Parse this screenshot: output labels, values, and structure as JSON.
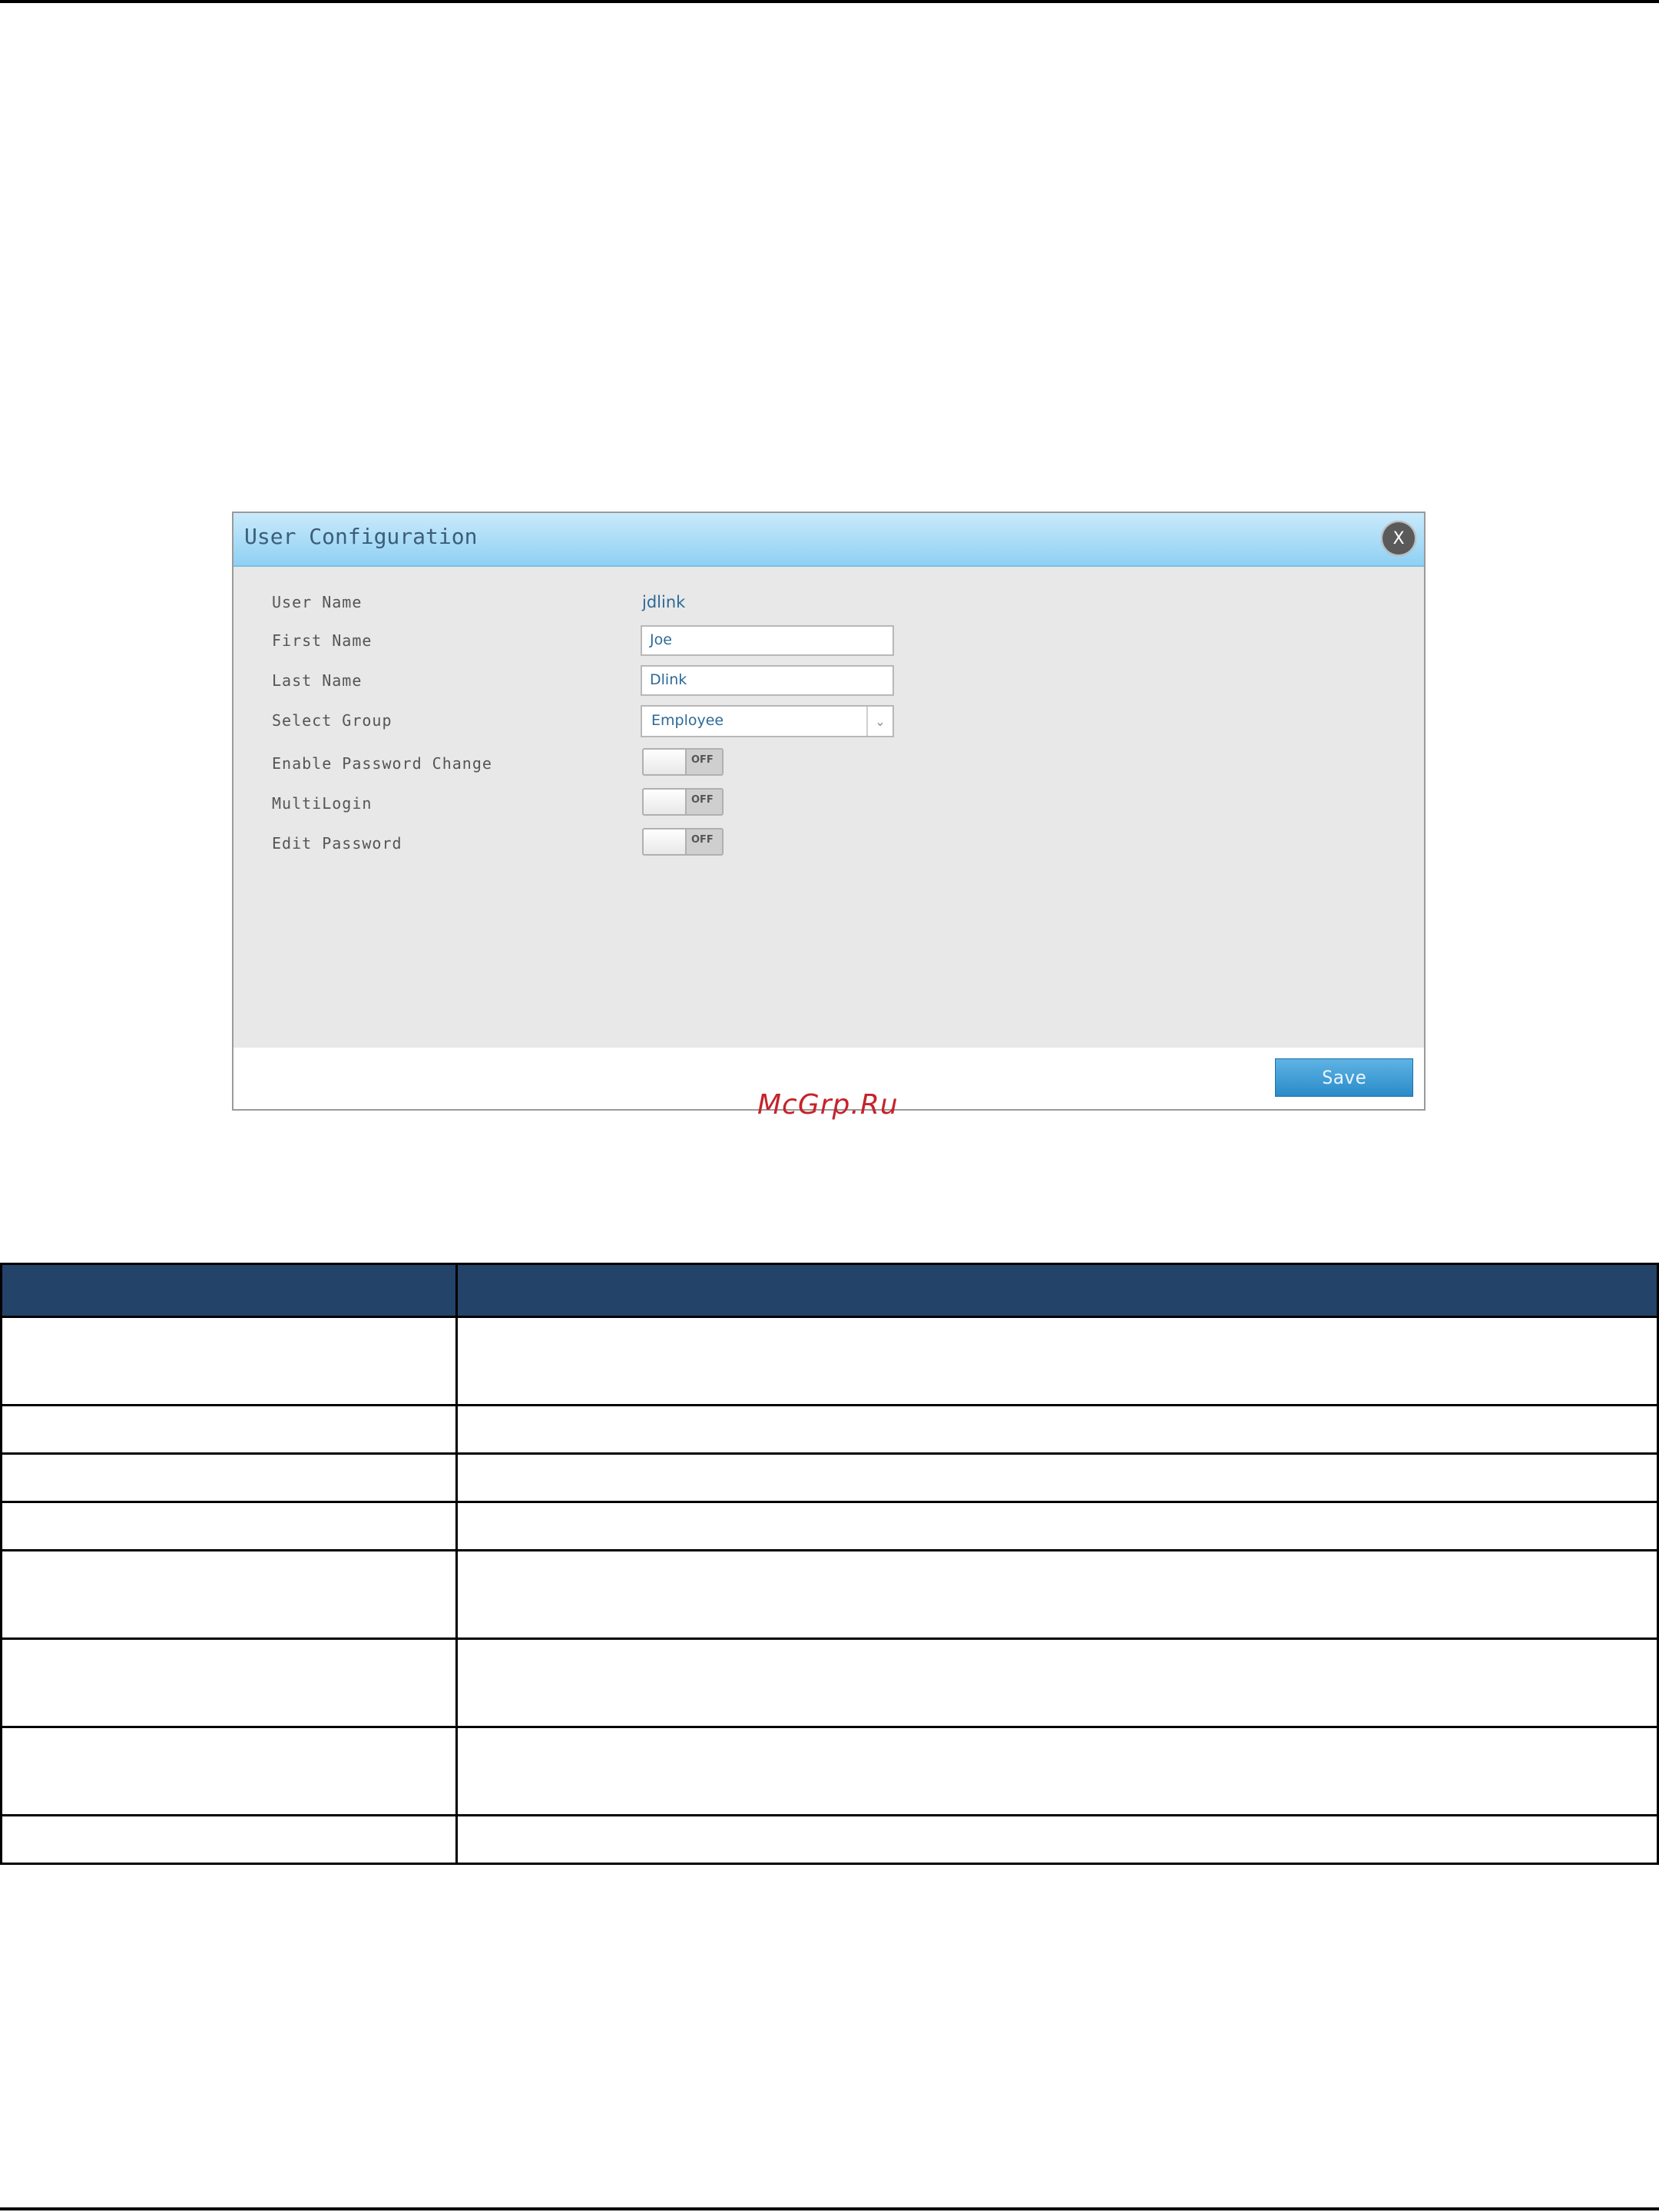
{
  "dialog": {
    "title": "User Configuration",
    "close_label": "X",
    "fields": {
      "user_name": {
        "label": "User Name",
        "value": "jdlink"
      },
      "first_name": {
        "label": "First Name",
        "value": "Joe"
      },
      "last_name": {
        "label": "Last Name",
        "value": "Dlink"
      },
      "select_group": {
        "label": "Select Group",
        "value": "Employee",
        "arrow": "⌄"
      },
      "enable_password_change": {
        "label": "Enable Password Change",
        "state": "OFF"
      },
      "multilogin": {
        "label": "MultiLogin",
        "state": "OFF"
      },
      "edit_password": {
        "label": "Edit Password",
        "state": "OFF"
      }
    },
    "save_label": "Save"
  },
  "watermark": "McGrp.Ru",
  "table": {
    "header_color": "#244368",
    "rows": [
      {
        "height": "tall"
      },
      {
        "height": "short"
      },
      {
        "height": "short"
      },
      {
        "height": "short"
      },
      {
        "height": "tall"
      },
      {
        "height": "tall"
      },
      {
        "height": "tall"
      },
      {
        "height": "short"
      }
    ]
  }
}
